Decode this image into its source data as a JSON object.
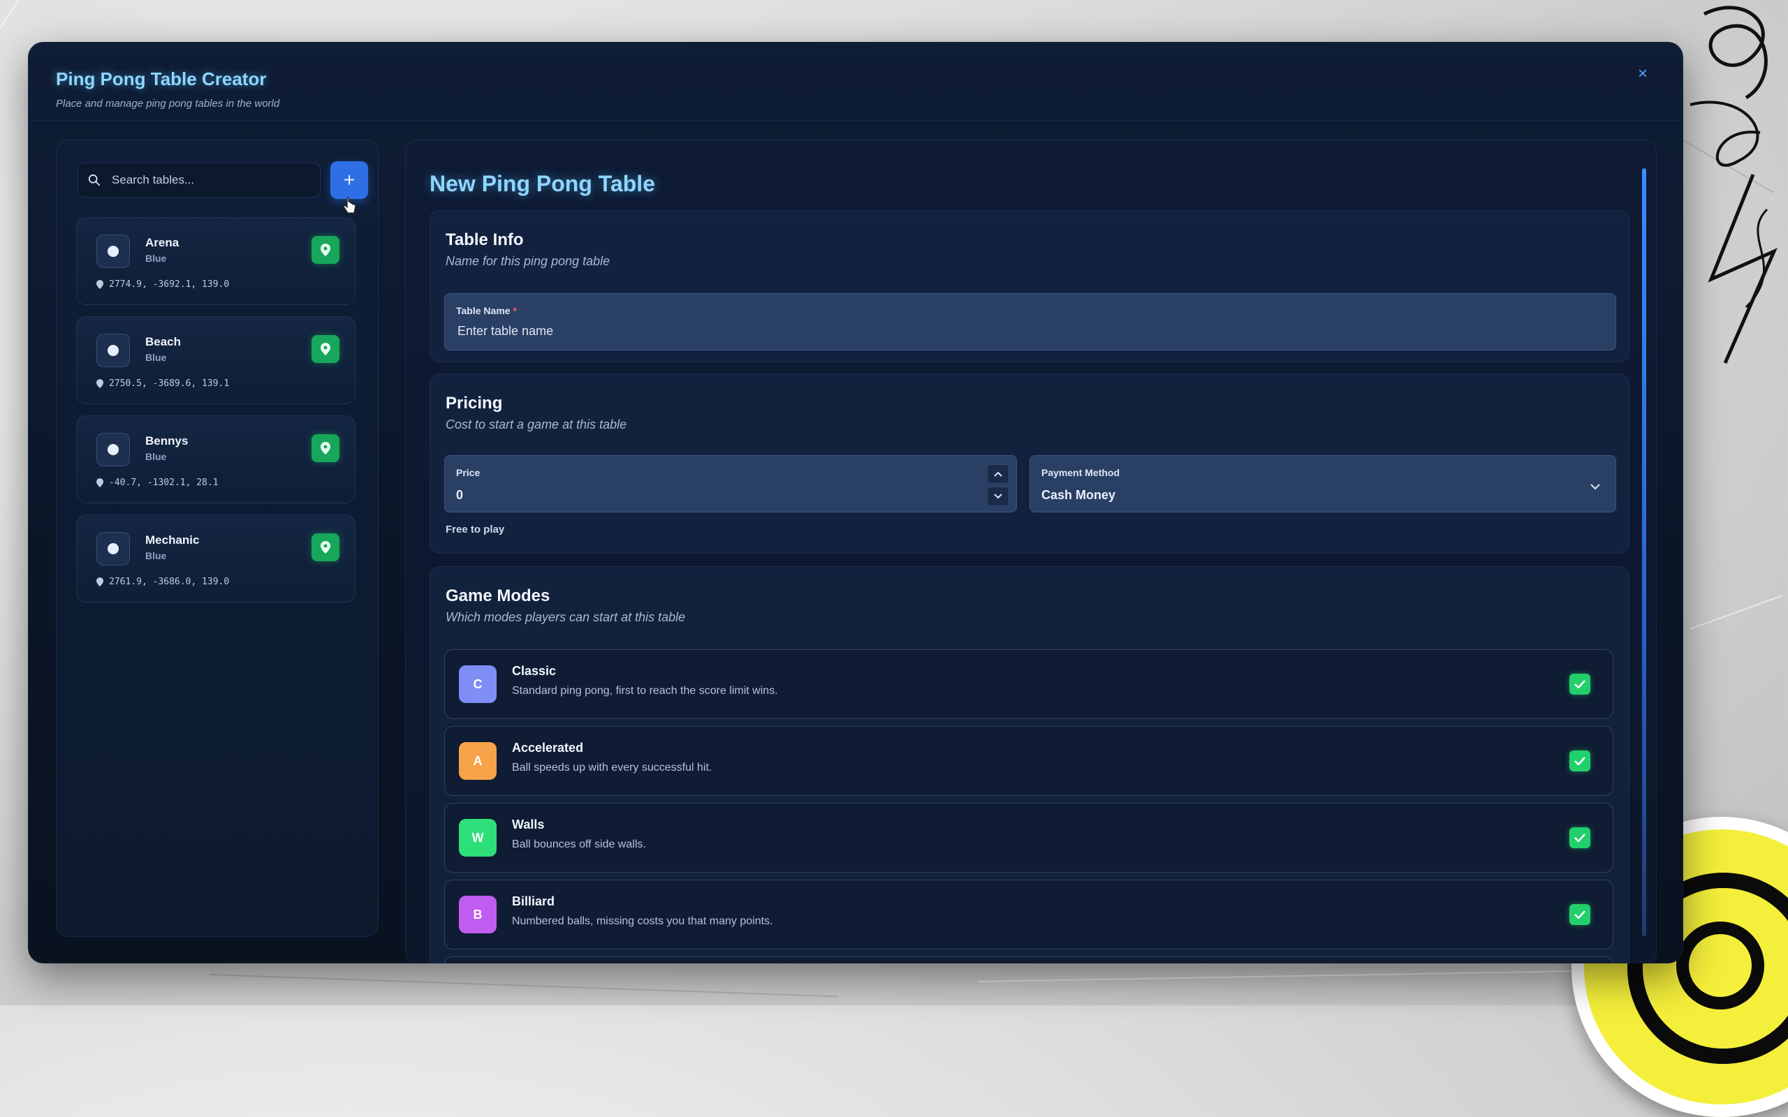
{
  "window": {
    "title": "Ping Pong Table Creator",
    "subtitle": "Place and manage ping pong tables in the world",
    "close_icon": "×"
  },
  "sidebar": {
    "search_placeholder": "Search tables...",
    "add_label": "+",
    "tables": [
      {
        "name": "Arena",
        "color": "Blue",
        "coords": "2774.9, -3692.1, 139.0"
      },
      {
        "name": "Beach",
        "color": "Blue",
        "coords": "2750.5, -3689.6, 139.1"
      },
      {
        "name": "Bennys",
        "color": "Blue",
        "coords": "-40.7, -1302.1, 28.1"
      },
      {
        "name": "Mechanic",
        "color": "Blue",
        "coords": "2761.9, -3686.0, 139.0"
      }
    ]
  },
  "main": {
    "title": "New Ping Pong Table",
    "table_info": {
      "title": "Table Info",
      "desc": "Name for this ping pong table",
      "name_label": "Table Name",
      "required_mark": "*",
      "name_placeholder": "Enter table name"
    },
    "pricing": {
      "title": "Pricing",
      "desc": "Cost to start a game at this table",
      "price_label": "Price",
      "price_value": "0",
      "payment_label": "Payment Method",
      "payment_value": "Cash Money",
      "helper": "Free to play"
    },
    "game_modes": {
      "title": "Game Modes",
      "desc": "Which modes players can start at this table",
      "modes": [
        {
          "letter": "C",
          "name": "Classic",
          "desc": "Standard ping pong, first to reach the score limit wins.",
          "color": "#7f8ef5",
          "enabled": true
        },
        {
          "letter": "A",
          "name": "Accelerated",
          "desc": "Ball speeds up with every successful hit.",
          "color": "#f7a34a",
          "enabled": true
        },
        {
          "letter": "W",
          "name": "Walls",
          "desc": "Ball bounces off side walls.",
          "color": "#2ee07a",
          "enabled": true
        },
        {
          "letter": "B",
          "name": "Billiard",
          "desc": "Numbered balls, missing costs you that many points.",
          "color": "#c05cf0",
          "enabled": true
        }
      ]
    }
  }
}
